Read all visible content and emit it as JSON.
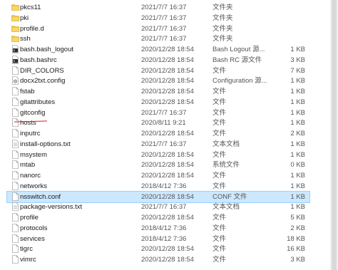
{
  "files": [
    {
      "name": "pkcs11",
      "date": "2021/7/7 16:37",
      "type": "文件夹",
      "size": "",
      "icon": "folder-icon"
    },
    {
      "name": "pki",
      "date": "2021/7/7 16:37",
      "type": "文件夹",
      "size": "",
      "icon": "folder-icon"
    },
    {
      "name": "profile.d",
      "date": "2021/7/7 16:37",
      "type": "文件夹",
      "size": "",
      "icon": "folder-icon"
    },
    {
      "name": "ssh",
      "date": "2021/7/7 16:37",
      "type": "文件夹",
      "size": "",
      "icon": "folder-icon"
    },
    {
      "name": "bash.bash_logout",
      "date": "2020/12/28 18:54",
      "type": "Bash Logout 源...",
      "size": "1 KB",
      "icon": "bash-script-icon"
    },
    {
      "name": "bash.bashrc",
      "date": "2020/12/28 18:54",
      "type": "Bash RC 源文件",
      "size": "3 KB",
      "icon": "bash-script-icon"
    },
    {
      "name": "DIR_COLORS",
      "date": "2020/12/28 18:54",
      "type": "文件",
      "size": "7 KB",
      "icon": "file-icon"
    },
    {
      "name": "docx2txt.config",
      "date": "2020/12/28 18:54",
      "type": "Configuration 源...",
      "size": "1 KB",
      "icon": "config-file-icon"
    },
    {
      "name": "fstab",
      "date": "2020/12/28 18:54",
      "type": "文件",
      "size": "1 KB",
      "icon": "file-icon"
    },
    {
      "name": "gitattributes",
      "date": "2020/12/28 18:54",
      "type": "文件",
      "size": "1 KB",
      "icon": "file-icon"
    },
    {
      "name": "gitconfig",
      "date": "2021/7/7 16:37",
      "type": "文件",
      "size": "1 KB",
      "icon": "file-icon"
    },
    {
      "name": "hosts",
      "date": "2020/8/11 9:21",
      "type": "文件",
      "size": "1 KB",
      "icon": "file-icon"
    },
    {
      "name": "inputrc",
      "date": "2020/12/28 18:54",
      "type": "文件",
      "size": "2 KB",
      "icon": "file-icon"
    },
    {
      "name": "install-options.txt",
      "date": "2021/7/7 16:37",
      "type": "文本文档",
      "size": "1 KB",
      "icon": "text-file-icon"
    },
    {
      "name": "msystem",
      "date": "2020/12/28 18:54",
      "type": "文件",
      "size": "1 KB",
      "icon": "file-icon"
    },
    {
      "name": "mtab",
      "date": "2020/12/28 18:54",
      "type": "系统文件",
      "size": "0 KB",
      "icon": "file-icon"
    },
    {
      "name": "nanorc",
      "date": "2020/12/28 18:54",
      "type": "文件",
      "size": "1 KB",
      "icon": "file-icon"
    },
    {
      "name": "networks",
      "date": "2018/4/12 7:36",
      "type": "文件",
      "size": "1 KB",
      "icon": "file-icon"
    },
    {
      "name": "nsswitch.conf",
      "date": "2020/12/28 18:54",
      "type": "CONF 文件",
      "size": "1 KB",
      "icon": "file-icon",
      "selected": true
    },
    {
      "name": "package-versions.txt",
      "date": "2021/7/7 16:37",
      "type": "文本文档",
      "size": "1 KB",
      "icon": "text-file-icon"
    },
    {
      "name": "profile",
      "date": "2020/12/28 18:54",
      "type": "文件",
      "size": "5 KB",
      "icon": "file-icon"
    },
    {
      "name": "protocols",
      "date": "2018/4/12 7:36",
      "type": "文件",
      "size": "2 KB",
      "icon": "file-icon"
    },
    {
      "name": "services",
      "date": "2018/4/12 7:36",
      "type": "文件",
      "size": "18 KB",
      "icon": "file-icon"
    },
    {
      "name": "tigrc",
      "date": "2020/12/28 18:54",
      "type": "文件",
      "size": "16 KB",
      "icon": "file-icon"
    },
    {
      "name": "vimrc",
      "date": "2020/12/28 18:54",
      "type": "文件",
      "size": "3 KB",
      "icon": "file-icon"
    }
  ],
  "colors": {
    "folder": "#f2c84b",
    "selection": "#cce8ff",
    "annotation": "#d81e1e"
  }
}
